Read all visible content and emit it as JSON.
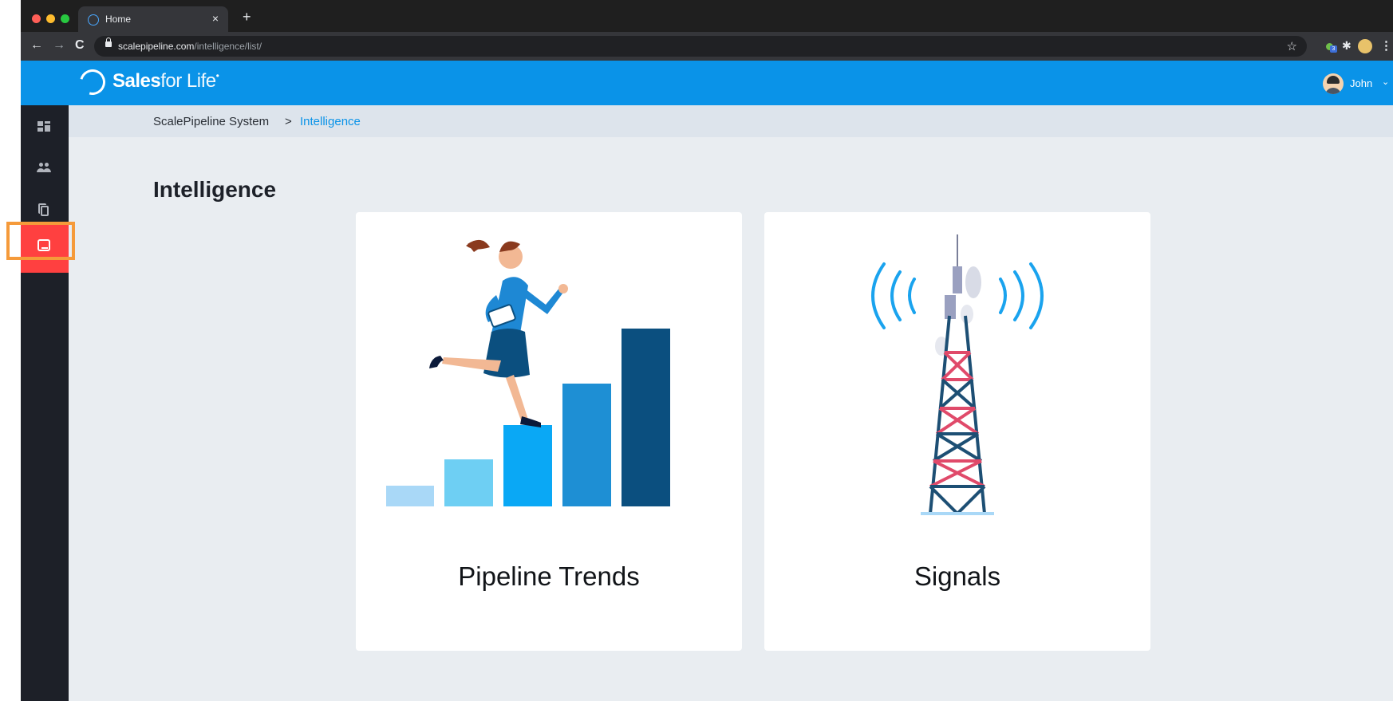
{
  "browser": {
    "tab_title": "Home",
    "tab_close": "×",
    "new_tab": "+",
    "url_host": "scalepipeline.com",
    "url_path": "/intelligence/list/"
  },
  "header": {
    "logo_bold": "Sales",
    "logo_light": "for Life",
    "logo_mark": "•",
    "user_name": "John"
  },
  "breadcrumb": {
    "root": "ScalePipeline System",
    "separator": ">",
    "current": "Intelligence"
  },
  "main": {
    "title": "Intelligence",
    "cards": [
      {
        "label": "Pipeline Trends",
        "icon": "pipeline-trends-illustration"
      },
      {
        "label": "Signals",
        "icon": "signal-tower-illustration"
      }
    ]
  },
  "sidebar": {
    "items": [
      {
        "icon": "dashboard-icon",
        "active": false
      },
      {
        "icon": "users-icon",
        "active": false
      },
      {
        "icon": "documents-icon",
        "active": false
      },
      {
        "icon": "inbox-icon",
        "active": true
      }
    ]
  },
  "colors": {
    "header_blue": "#0a93e8",
    "sidebar_dark": "#1d2028",
    "active_red": "#ff4040",
    "highlight_orange": "#f59a3a"
  }
}
